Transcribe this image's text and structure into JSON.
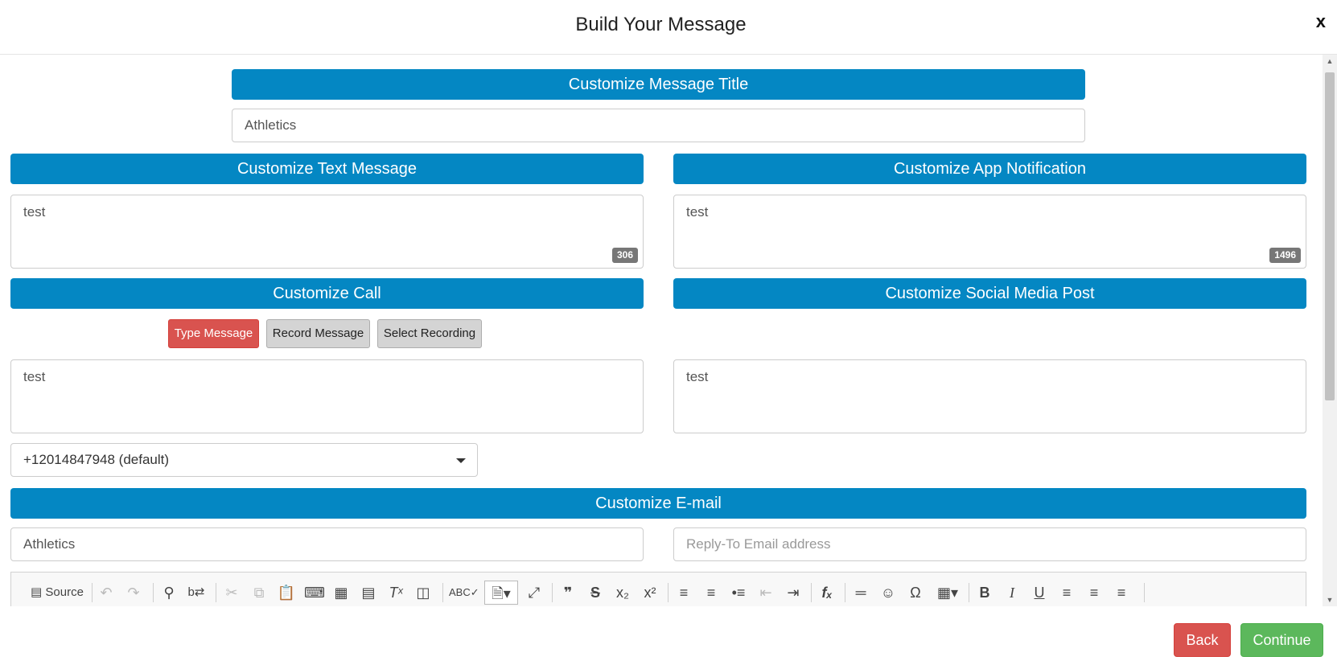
{
  "modal": {
    "title": "Build Your Message",
    "close_label": "x"
  },
  "sections": {
    "message_title": {
      "header": "Customize Message Title",
      "value": "Athletics"
    },
    "text_message": {
      "header": "Customize Text Message",
      "value": "test",
      "counter": "306"
    },
    "app_notification": {
      "header": "Customize App Notification",
      "value": "test",
      "counter": "1496"
    },
    "call": {
      "header": "Customize Call",
      "buttons": {
        "type_message": "Type Message",
        "record_message": "Record Message",
        "select_recording": "Select Recording"
      },
      "value": "test",
      "caller_id": "+12014847948 (default)"
    },
    "social_media": {
      "header": "Customize Social Media Post",
      "value": "test"
    },
    "email": {
      "header": "Customize E-mail",
      "subject": "Athletics",
      "reply_to_placeholder": "Reply-To Email address",
      "toolbar_source": "Source"
    }
  },
  "footer": {
    "back_label": "Back",
    "continue_label": "Continue"
  },
  "colors": {
    "section_bar": "#0487c3",
    "danger": "#d9534f",
    "success": "#5cb85c"
  }
}
